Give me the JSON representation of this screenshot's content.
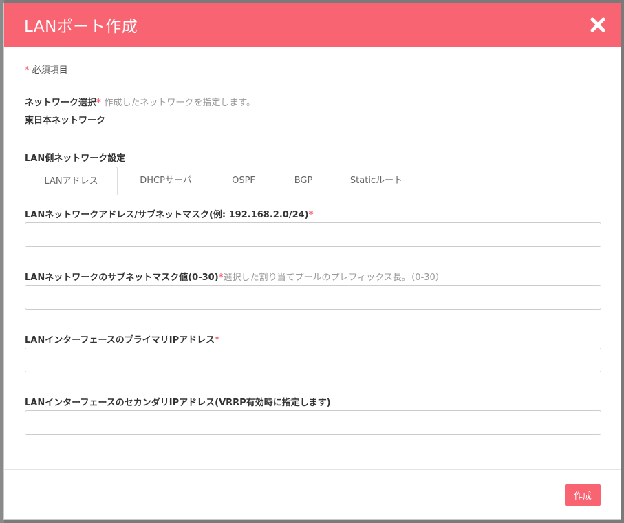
{
  "modal": {
    "title": "LANポート作成",
    "close_icon": "close-icon"
  },
  "required_note": {
    "star": "*",
    "text": "必須項目"
  },
  "network_select": {
    "label": "ネットワーク選択",
    "star": "*",
    "hint": "作成したネットワークを指定します。",
    "value": "東日本ネットワーク"
  },
  "lan_settings": {
    "label": "LAN側ネットワーク設定",
    "tabs": [
      {
        "label": "LANアドレス",
        "active": true
      },
      {
        "label": "DHCPサーバ",
        "active": false
      },
      {
        "label": "OSPF",
        "active": false
      },
      {
        "label": "BGP",
        "active": false
      },
      {
        "label": "Staticルート",
        "active": false
      }
    ]
  },
  "fields": [
    {
      "label": "LANネットワークアドレス/サブネットマスク(例: 192.168.2.0/24)",
      "star": "*",
      "hint": "",
      "value": "",
      "placeholder": ""
    },
    {
      "label": "LANネットワークのサブネットマスク値(0-30)",
      "star": "*",
      "hint": "選択した割り当てプールのプレフィックス長。（0-30）",
      "value": "",
      "placeholder": ""
    },
    {
      "label": "LANインターフェースのプライマリIPアドレス",
      "star": "*",
      "hint": "",
      "value": "",
      "placeholder": ""
    },
    {
      "label": "LANインターフェースのセカンダリIPアドレス(VRRP有効時に指定します)",
      "star": "",
      "hint": "",
      "value": "",
      "placeholder": ""
    }
  ],
  "footer": {
    "create_label": "作成"
  },
  "colors": {
    "accent": "#f96472",
    "required": "#f96472"
  }
}
